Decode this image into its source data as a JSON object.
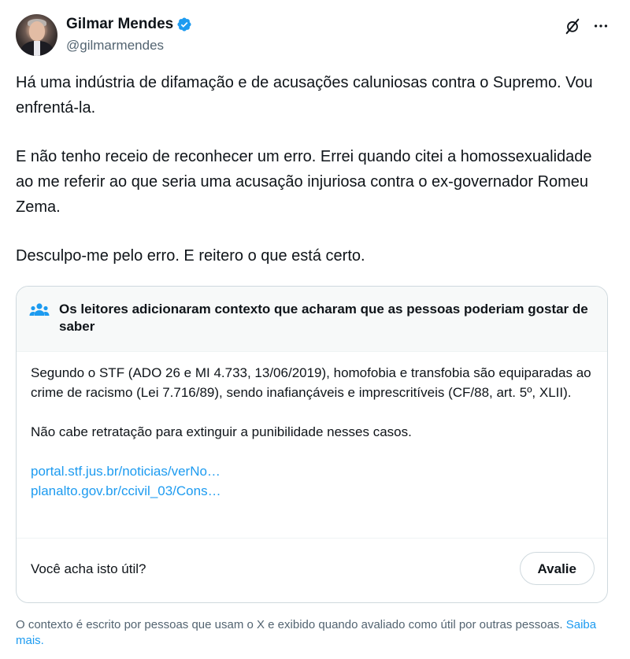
{
  "author": {
    "display_name": "Gilmar Mendes",
    "handle": "@gilmarmendes",
    "verified": true
  },
  "tweet": {
    "paragraphs": [
      "Há uma indústria de difamação e de acusações caluniosas contra o Supremo. Vou enfrentá-la.",
      "E não tenho receio de reconhecer um erro. Errei quando citei a homossexualidade ao me referir ao que seria uma acusação injuriosa contra o ex-governador Romeu Zema.",
      "Desculpo-me pelo erro. E reitero o que está certo."
    ]
  },
  "community_note": {
    "title": "Os leitores adicionaram contexto que acharam que as pessoas poderiam gostar de saber",
    "body": [
      "Segundo o STF (ADO 26 e MI 4.733, 13/06/2019), homofobia e transfobia são equiparadas ao crime de racismo (Lei 7.716/89), sendo inafiançáveis e imprescritíveis (CF/88, art. 5º, XLII).",
      "Não cabe retratação para extinguir a punibilidade nesses casos."
    ],
    "links": [
      "portal.stf.jus.br/noticias/verNo…",
      "planalto.gov.br/ccivil_03/Cons…"
    ],
    "helpful_question": "Você acha isto útil?",
    "rate_label": "Avalie"
  },
  "disclaimer": {
    "text": "O contexto é escrito por pessoas que usam o X e exibido quando avaliado como útil por outras pessoas.",
    "link_label": "Saiba mais."
  },
  "icons": {
    "verified": "verified-badge-icon",
    "grok": "grok-icon",
    "more": "more-options-icon",
    "people": "community-notes-people-icon"
  },
  "colors": {
    "accent": "#1d9bf0",
    "text_primary": "#0f1419",
    "text_secondary": "#536471",
    "border": "#cfd9de",
    "note_header_bg": "#f7f9f9"
  }
}
